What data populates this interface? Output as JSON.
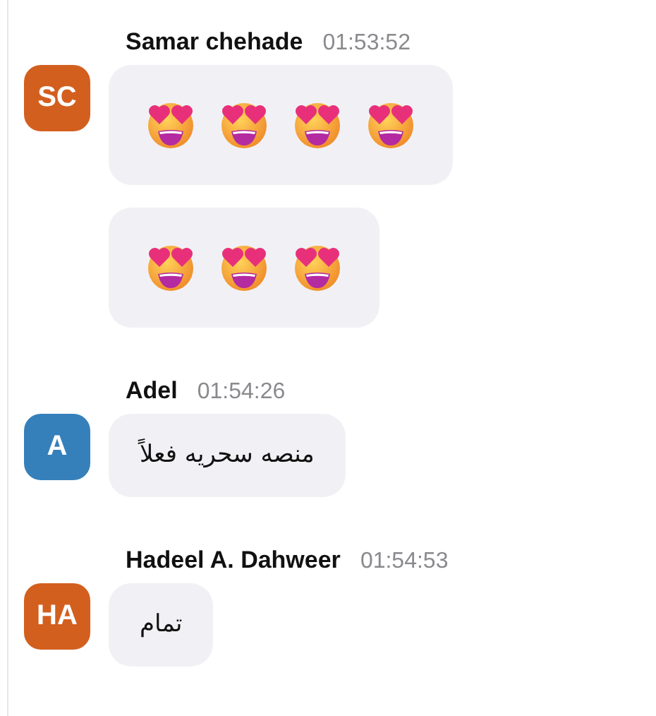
{
  "groups": [
    {
      "author": "Samar chehade",
      "time": "01:53:52",
      "avatar": {
        "initials": "SC",
        "color": "#d35f1e"
      },
      "messages": [
        {
          "kind": "emoji",
          "emojis": [
            {
              "kind": "heart-eyes"
            },
            {
              "kind": "heart-eyes"
            },
            {
              "kind": "heart-eyes"
            },
            {
              "kind": "heart-eyes"
            }
          ]
        },
        {
          "kind": "emoji",
          "emojis": [
            {
              "kind": "heart-eyes"
            },
            {
              "kind": "heart-eyes"
            },
            {
              "kind": "heart-eyes"
            }
          ]
        }
      ]
    },
    {
      "author": "Adel",
      "time": "01:54:26",
      "avatar": {
        "initials": "A",
        "color": "#3580bb"
      },
      "messages": [
        {
          "kind": "text",
          "text": "منصه سحريه فعلاً"
        }
      ]
    },
    {
      "author": "Hadeel A. Dahweer",
      "time": "01:54:53",
      "avatar": {
        "initials": "HA",
        "color": "#d35f1e"
      },
      "messages": [
        {
          "kind": "text",
          "text": "تمام"
        }
      ]
    }
  ]
}
